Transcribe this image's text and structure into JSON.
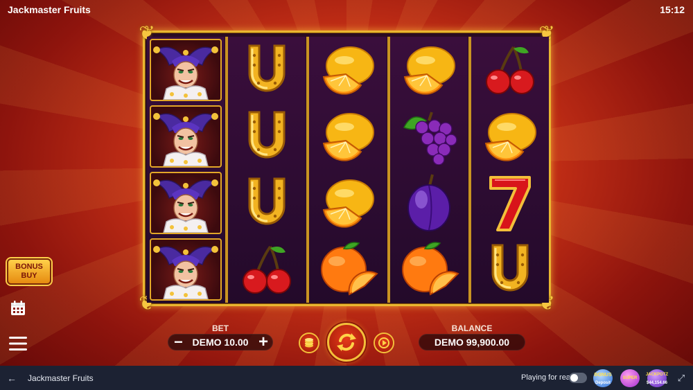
{
  "game": {
    "title": "Jackmaster Fruits",
    "clock": "15:12"
  },
  "reels": [
    [
      "jester",
      "jester",
      "jester",
      "jester"
    ],
    [
      "horseshoe",
      "horseshoe",
      "horseshoe",
      "cherry"
    ],
    [
      "lemon",
      "lemon",
      "lemon",
      "orange"
    ],
    [
      "lemon",
      "grapes",
      "plum",
      "orange"
    ],
    [
      "cherry",
      "lemon",
      "seven",
      "horseshoe"
    ]
  ],
  "left_controls": {
    "bonus_buy_line1": "BONUS",
    "bonus_buy_line2": "BUY",
    "calendar_icon": "calendar-icon",
    "menu_icon": "menu-icon"
  },
  "bet": {
    "label": "BET",
    "value": "DEMO 10.00",
    "minus": "−",
    "plus": "+"
  },
  "balance": {
    "label": "BALANCE",
    "value": "DEMO 99,900.00"
  },
  "bottom_bar": {
    "back": "←",
    "title": "Jackmaster Fruits",
    "playing_for_real": "Playing for real",
    "promo1_text": "Deposit",
    "promo1_badge": "BONUS",
    "promo2_badge": "SUPER",
    "promo3_badge": "JACKPOTZ",
    "promo3_amount": "$44,154.66",
    "more": "⤢"
  },
  "colors": {
    "gold": "#e9b631",
    "spin_red": "#d82c12",
    "bar": "#1c2233"
  }
}
